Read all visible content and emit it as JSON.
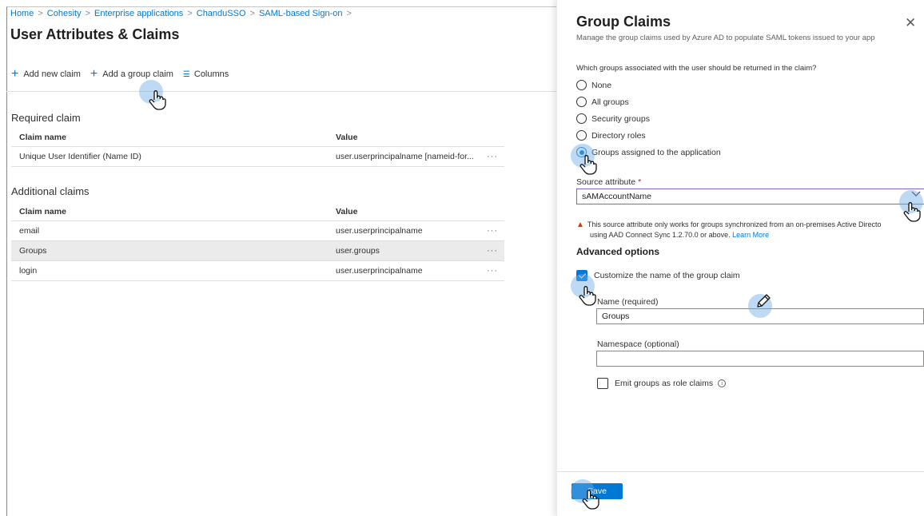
{
  "breadcrumb": [
    "Home",
    "Cohesity",
    "Enterprise applications",
    "ChanduSSO",
    "SAML-based Sign-on"
  ],
  "breadcrumb_sep": ">",
  "page_title": "User Attributes & Claims",
  "toolbar": {
    "add_claim": "Add new claim",
    "add_group_claim": "Add a group claim",
    "columns": "Columns"
  },
  "required": {
    "title": "Required claim",
    "headers": {
      "name": "Claim name",
      "value": "Value"
    },
    "rows": [
      {
        "name": "Unique User Identifier (Name ID)",
        "value": "user.userprincipalname [nameid-for...",
        "more": "···"
      }
    ]
  },
  "additional": {
    "title": "Additional claims",
    "headers": {
      "name": "Claim name",
      "value": "Value"
    },
    "rows": [
      {
        "name": "email",
        "value": "user.userprincipalname",
        "more": "···"
      },
      {
        "name": "Groups",
        "value": "user.groups",
        "more": "···"
      },
      {
        "name": "login",
        "value": "user.userprincipalname",
        "more": "···"
      }
    ]
  },
  "panel": {
    "title": "Group Claims",
    "close": "✕",
    "subtitle": "Manage the group claims used by Azure AD to populate SAML tokens issued to your app",
    "question": "Which groups associated with the user should be returned in the claim?",
    "options": [
      "None",
      "All groups",
      "Security groups",
      "Directory roles",
      "Groups assigned to the application"
    ],
    "selected_option": "Groups assigned to the application",
    "source_label": "Source attribute",
    "required_mark": "*",
    "source_value": "sAMAccountName",
    "warning_line1": "This source attribute only works for groups synchronized from an on-premises Active Directo",
    "warning_line2": "using AAD Connect Sync 1.2.70.0 or above.",
    "learn_more": "Learn More",
    "advanced_title": "Advanced options",
    "customize_label": "Customize the name of the group claim",
    "name_label": "Name (required)",
    "name_value": "Groups",
    "namespace_label": "Namespace (optional)",
    "namespace_value": "",
    "emit_label": "Emit groups as role claims",
    "save": "Save"
  },
  "colors": {
    "accent": "#0078d4",
    "select_border": "#8764b8",
    "warning": "#d83b01",
    "cursor_highlight": "#6caae6"
  }
}
